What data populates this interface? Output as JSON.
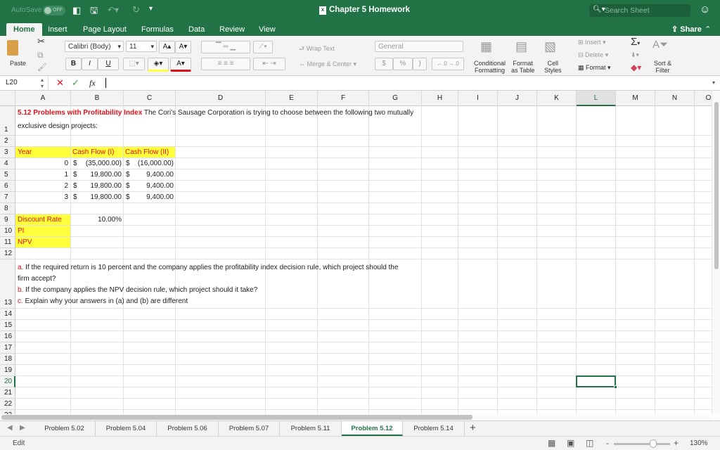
{
  "titlebar": {
    "autosave": "AutoSave",
    "autosave_state": "OFF",
    "title": "Chapter 5 Homework",
    "search_placeholder": "Search Sheet"
  },
  "ribbon_tabs": [
    "Home",
    "Insert",
    "Page Layout",
    "Formulas",
    "Data",
    "Review",
    "View"
  ],
  "share": "Share",
  "ribbon": {
    "paste": "Paste",
    "font_name": "Calibri (Body)",
    "font_size": "11",
    "bold": "B",
    "italic": "I",
    "underline": "U",
    "wrap_text": "Wrap Text",
    "merge_center": "Merge & Center",
    "number_format": "General",
    "currency": "$",
    "percent": "%",
    "comma": ")",
    "cond_fmt_1": "Conditional",
    "cond_fmt_2": "Formatting",
    "fmt_table_1": "Format",
    "fmt_table_2": "as Table",
    "cell_styles_1": "Cell",
    "cell_styles_2": "Styles",
    "insert": "Insert",
    "delete": "Delete",
    "format": "Format",
    "sort_1": "Sort &",
    "sort_2": "Filter",
    "font_color": "#e0101a",
    "fill_color": "#ffff3c"
  },
  "formula_bar": {
    "name_box": "L20",
    "fx": "fx",
    "value": ""
  },
  "columns": [
    "A",
    "B",
    "C",
    "D",
    "E",
    "F",
    "G",
    "H",
    "I",
    "J",
    "K",
    "L",
    "M",
    "N",
    "O"
  ],
  "selected_cell": "L20",
  "rows": [
    "1",
    "2",
    "3",
    "4",
    "5",
    "6",
    "7",
    "8",
    "9",
    "10",
    "11",
    "12",
    "13",
    "14",
    "15",
    "16",
    "17",
    "18",
    "19",
    "20",
    "21",
    "22",
    "23"
  ],
  "sheet": {
    "title_bold": "5.12 Problems with Profitability Index",
    "title_rest": " The Cori's Sausage Corporation is trying to choose between the following two mutually",
    "title_line2": "exclusive design projects:",
    "header": [
      "Year",
      "Cash Flow (I)",
      "Cash Flow (II)"
    ],
    "cashflows": [
      {
        "year": "0",
        "cf1": "(35,000.00)",
        "cf2": "(16,000.00)"
      },
      {
        "year": "1",
        "cf1": "19,800.00 ",
        "cf2": "9,400.00 "
      },
      {
        "year": "2",
        "cf1": "19,800.00 ",
        "cf2": "9,400.00 "
      },
      {
        "year": "3",
        "cf1": "19,800.00 ",
        "cf2": "9,400.00 "
      }
    ],
    "currency_symbol": "$",
    "discount_label": "Discount Rate",
    "discount_value": "10.00%",
    "pi_label": "PI",
    "npv_label": "NPV",
    "q": [
      {
        "letter": "a.",
        "text": " If the required return is 10 percent and the company applies the profitability index decision rule, which project should the"
      },
      {
        "letter": "",
        "text": "firm accept?"
      },
      {
        "letter": "b.",
        "text": " If the company applies the NPV decision rule, which project should it take?"
      },
      {
        "letter": "c.",
        "text": " Explain why your answers in (a) and (b) are different"
      }
    ]
  },
  "sheet_tabs": [
    "Problem 5.02",
    "Problem 5.04",
    "Problem 5.06",
    "Problem 5.07",
    "Problem 5.11",
    "Problem 5.12",
    "Problem 5.14"
  ],
  "active_sheet": "Problem 5.12",
  "status": {
    "mode": "Edit",
    "zoom": "130%",
    "zoom_level_percent": 130
  },
  "accent": "#217346"
}
